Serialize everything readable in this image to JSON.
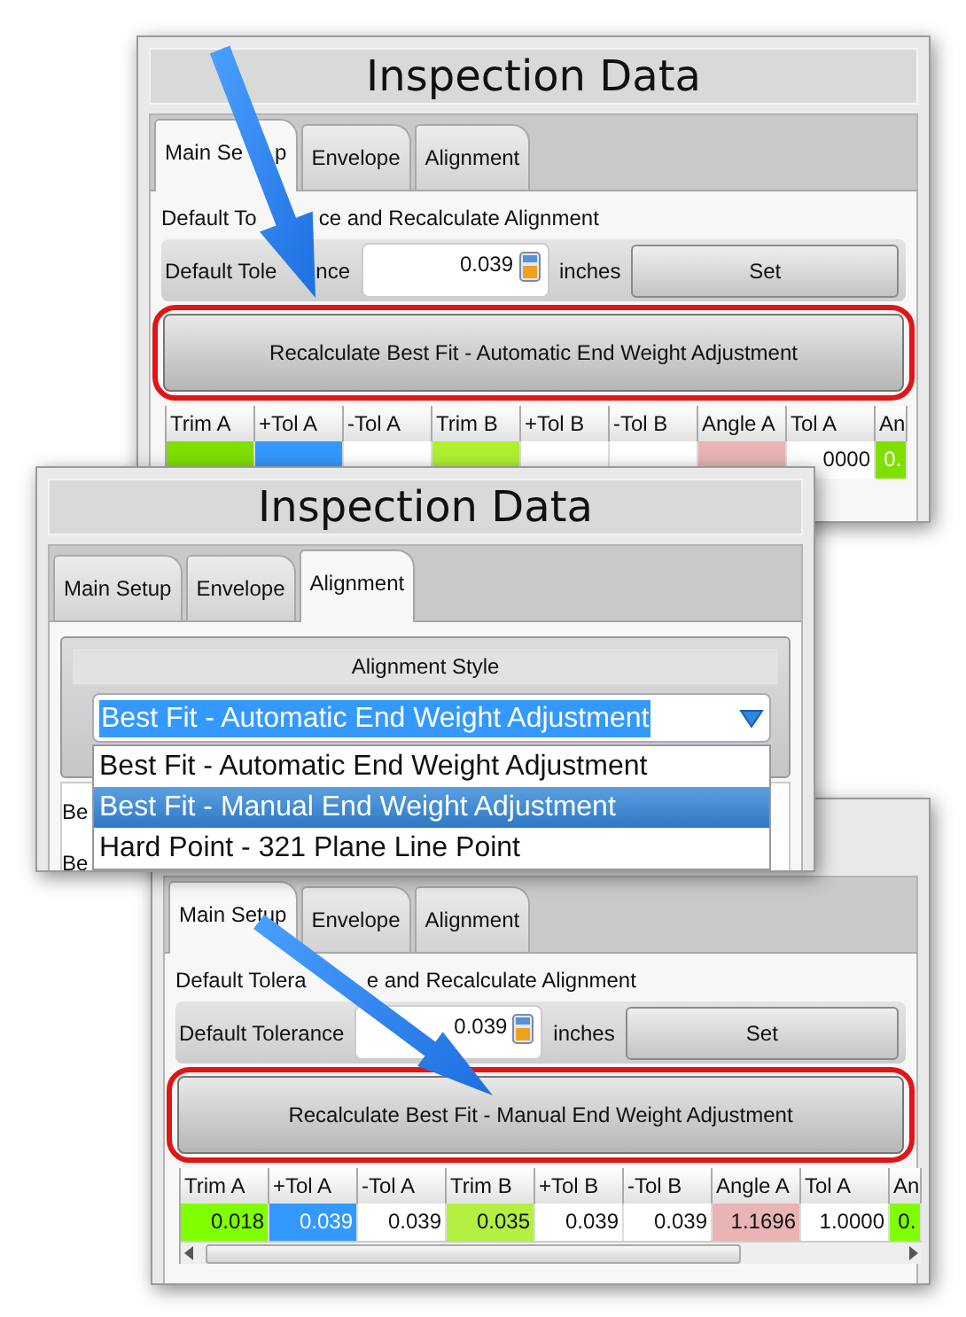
{
  "windows": [
    {
      "title": "Inspection Data",
      "tabs": [
        {
          "label": [
            "Main Se",
            "p"
          ],
          "selected": true
        },
        {
          "label": "Envelope",
          "selected": false
        },
        {
          "label": "Alignment",
          "selected": false
        }
      ],
      "content": {
        "kind": "main_setup",
        "section_label": [
          "Default To",
          "ce and Recalculate Alignment"
        ],
        "tolerance_label": [
          "Default Tole",
          "nce"
        ],
        "tolerance_value": "0.039",
        "unit": "inches",
        "set_button": "Set",
        "recalc_button": "Recalculate Best Fit - Automatic End Weight Adjustment",
        "highlighted": true,
        "table": {
          "columns": [
            "Trim A",
            "+Tol A",
            "-Tol A",
            "Trim B",
            "+Tol B",
            "-Tol B",
            "Angle A",
            "Tol A",
            "An"
          ],
          "cells": [
            {
              "color": "#7fe000"
            },
            {
              "color": "#3399ff"
            },
            {
              "color": "#ffffff"
            },
            {
              "color": "#b0f030"
            },
            {
              "color": "#ffffff"
            },
            {
              "color": "#ffffff"
            },
            {
              "color": "#e8b4b4"
            },
            {
              "color": "#ffffff",
              "value": "0000"
            },
            {
              "color": "#7fe000",
              "value": "0."
            }
          ]
        }
      }
    },
    {
      "title": "Inspection Data",
      "tabs": [
        {
          "label": "Main Setup",
          "selected": false
        },
        {
          "label": "Envelope",
          "selected": false
        },
        {
          "label": "Alignment",
          "selected": true
        }
      ],
      "content": {
        "kind": "alignment",
        "group_title": "Alignment Style",
        "combo_value": "Best Fit - Automatic End Weight Adjustment",
        "options": [
          {
            "label": "Best Fit - Automatic End Weight Adjustment",
            "selected": false
          },
          {
            "label": "Best Fit - Manual End Weight Adjustment",
            "selected": true
          },
          {
            "label": "Hard Point - 321 Plane Line Point",
            "selected": false
          }
        ],
        "partial_labels": [
          "Be",
          "Be"
        ]
      }
    },
    {
      "tabs": [
        {
          "label": "Main Setup",
          "selected": true
        },
        {
          "label": "Envelope",
          "selected": false
        },
        {
          "label": "Alignment",
          "selected": false
        }
      ],
      "content": {
        "kind": "main_setup",
        "section_label": [
          "Default Tolera",
          "e and Recalculate Alignment"
        ],
        "tolerance_label": "Default Tolerance",
        "tolerance_value": "0.039",
        "unit": "inches",
        "set_button": "Set",
        "recalc_button": "Recalculate Best Fit - Manual End Weight Adjustment",
        "highlighted": true,
        "table": {
          "columns": [
            "Trim A",
            "+Tol A",
            "-Tol A",
            "Trim B",
            "+Tol B",
            "-Tol B",
            "Angle A",
            "Tol A",
            "An"
          ],
          "cells": [
            {
              "color": "#7fff00",
              "value": "0.018"
            },
            {
              "color": "#3399ff",
              "value": "0.039"
            },
            {
              "color": "#ffffff",
              "value": "0.039"
            },
            {
              "color": "#b4f040",
              "value": "0.035"
            },
            {
              "color": "#ffffff",
              "value": "0.039"
            },
            {
              "color": "#ffffff",
              "value": "0.039"
            },
            {
              "color": "#e8b4b4",
              "value": "1.1696"
            },
            {
              "color": "#ffffff",
              "value": "1.0000"
            },
            {
              "color": "#7fff00",
              "value": "0."
            }
          ]
        }
      }
    }
  ]
}
